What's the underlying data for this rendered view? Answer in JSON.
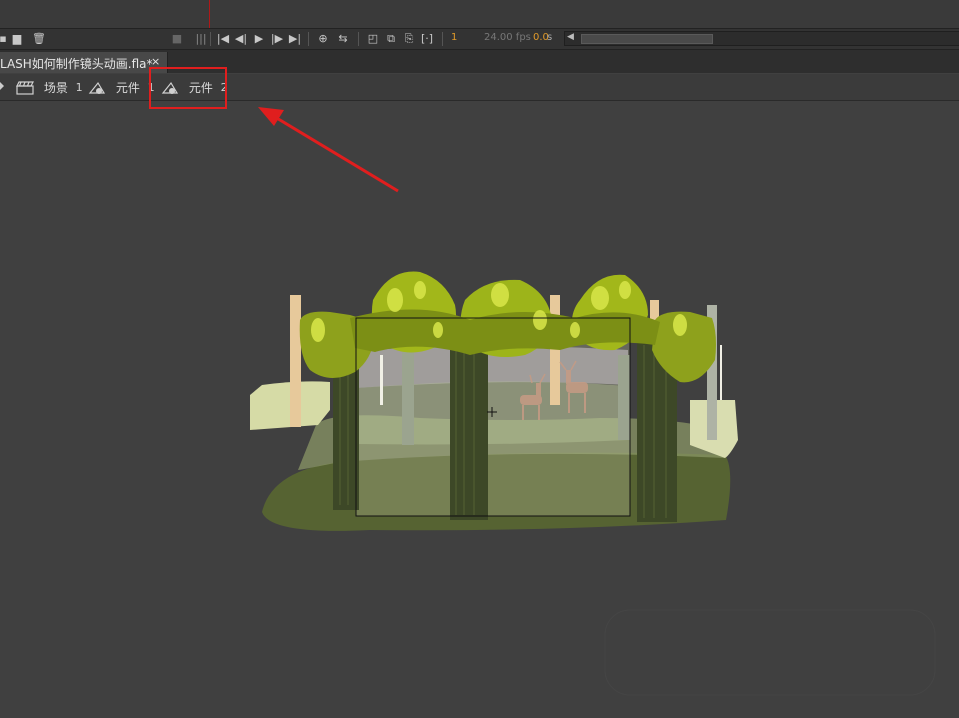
{
  "toolbar": {
    "frame_number": "1",
    "fps": "24.00 fps",
    "seconds": "0.0",
    "seconds_unit": "s"
  },
  "document_tab": {
    "title": "LASH如何制作镜头动画.fla*",
    "close_glyph": "×"
  },
  "breadcrumb": {
    "items": [
      {
        "label": "场景",
        "num": "1",
        "icon": "clapperboard-icon"
      },
      {
        "label": "元件",
        "num": "1",
        "icon": "movie-clip-symbol-icon"
      },
      {
        "label": "元件",
        "num": "2",
        "icon": "movie-clip-symbol-icon"
      }
    ]
  },
  "annotation": {
    "highlight_color": "#e01e1e"
  },
  "colors": {
    "panel_bg": "#404040",
    "toolbar_bg": "#333333",
    "accent_orange": "#e09a2a"
  }
}
